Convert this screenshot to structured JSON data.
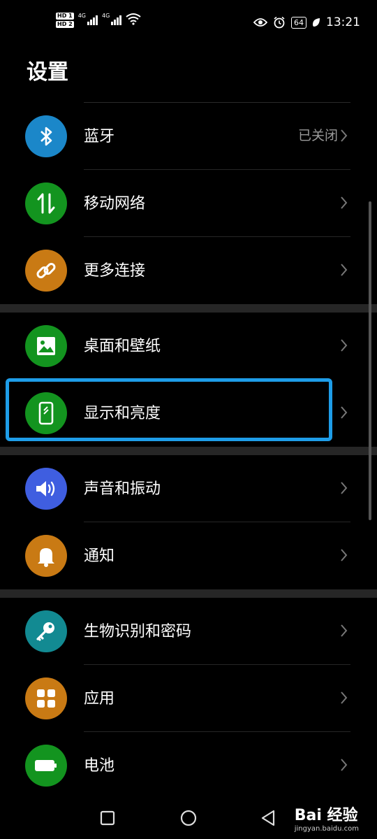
{
  "status_bar": {
    "sim1": "HD 1",
    "sim2": "HD 2",
    "net1": "4G",
    "net2": "4G",
    "battery": "64",
    "time": "13:21"
  },
  "page": {
    "title": "设置"
  },
  "items": [
    {
      "label": "蓝牙",
      "value": "已关闭",
      "icon": "bluetooth-icon",
      "color": "#1b87c9"
    },
    {
      "label": "移动网络",
      "value": "",
      "icon": "mobile-data-icon",
      "color": "#13941f"
    },
    {
      "label": "更多连接",
      "value": "",
      "icon": "link-icon",
      "color": "#c97a14"
    },
    {
      "label": "桌面和壁纸",
      "value": "",
      "icon": "wallpaper-icon",
      "color": "#13941f"
    },
    {
      "label": "显示和亮度",
      "value": "",
      "icon": "display-icon",
      "color": "#13941f"
    },
    {
      "label": "声音和振动",
      "value": "",
      "icon": "volume-icon",
      "color": "#3f5ee0"
    },
    {
      "label": "通知",
      "value": "",
      "icon": "bell-icon",
      "color": "#c97a14"
    },
    {
      "label": "生物识别和密码",
      "value": "",
      "icon": "key-icon",
      "color": "#128a92"
    },
    {
      "label": "应用",
      "value": "",
      "icon": "apps-icon",
      "color": "#c97a14"
    },
    {
      "label": "电池",
      "value": "",
      "icon": "battery-icon",
      "color": "#13941f"
    }
  ],
  "highlight_color": "#1e9de8",
  "watermark": {
    "brand": "Bai 经验",
    "url": "jingyan.baidu.com"
  }
}
